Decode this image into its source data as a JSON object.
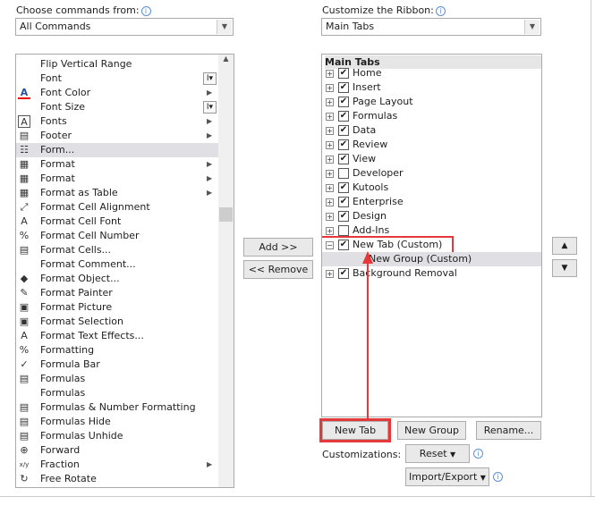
{
  "left": {
    "label": "Choose commands from:",
    "dropdown": "All Commands",
    "items": [
      {
        "label": "Flip Vertical Range",
        "icon": "none"
      },
      {
        "label": "Font",
        "icon": "none",
        "control": "I▾"
      },
      {
        "label": "Font Color",
        "icon": "font-color-icon",
        "sub": true
      },
      {
        "label": "Font Size",
        "icon": "none",
        "control": "I▾"
      },
      {
        "label": "Fonts",
        "icon": "fonts-icon",
        "sub": true
      },
      {
        "label": "Footer",
        "icon": "footer-icon",
        "sub": true
      },
      {
        "label": "Form...",
        "icon": "form-icon",
        "selected": true
      },
      {
        "label": "Format",
        "icon": "format-icon",
        "sub": true
      },
      {
        "label": "Format",
        "icon": "format-table-icon",
        "sub": true
      },
      {
        "label": "Format as Table",
        "icon": "format-as-table-icon",
        "sub": true
      },
      {
        "label": "Format Cell Alignment",
        "icon": "alignment-icon"
      },
      {
        "label": "Format Cell Font",
        "icon": "cell-font-icon"
      },
      {
        "label": "Format Cell Number",
        "icon": "percent-icon"
      },
      {
        "label": "Format Cells...",
        "icon": "format-cells-icon"
      },
      {
        "label": "Format Comment...",
        "icon": "none"
      },
      {
        "label": "Format Object...",
        "icon": "format-object-icon"
      },
      {
        "label": "Format Painter",
        "icon": "format-painter-icon"
      },
      {
        "label": "Format Picture",
        "icon": "format-picture-icon"
      },
      {
        "label": "Format Selection",
        "icon": "format-selection-icon"
      },
      {
        "label": "Format Text Effects...",
        "icon": "text-effects-icon"
      },
      {
        "label": "Formatting",
        "icon": "formatting-icon"
      },
      {
        "label": "Formula Bar",
        "icon": "check-icon"
      },
      {
        "label": "Formulas",
        "icon": "formulas-icon"
      },
      {
        "label": "Formulas",
        "icon": "none"
      },
      {
        "label": "Formulas & Number Formatting",
        "icon": "number-formatting-icon"
      },
      {
        "label": "Formulas Hide",
        "icon": "formulas-hide-icon"
      },
      {
        "label": "Formulas Unhide",
        "icon": "formulas-unhide-icon"
      },
      {
        "label": "Forward",
        "icon": "forward-icon"
      },
      {
        "label": "Fraction",
        "icon": "fraction-icon",
        "sub": true
      },
      {
        "label": "Free Rotate",
        "icon": "rotate-icon"
      }
    ]
  },
  "right": {
    "label": "Customize the Ribbon:",
    "dropdown": "Main Tabs",
    "header": "Main Tabs",
    "items": [
      {
        "label": "Home",
        "checked": true
      },
      {
        "label": "Insert",
        "checked": true
      },
      {
        "label": "Page Layout",
        "checked": true
      },
      {
        "label": "Formulas",
        "checked": true
      },
      {
        "label": "Data",
        "checked": true
      },
      {
        "label": "Review",
        "checked": true
      },
      {
        "label": "View",
        "checked": true
      },
      {
        "label": "Developer",
        "checked": false
      },
      {
        "label": "Kutools",
        "checked": true
      },
      {
        "label": "Enterprise",
        "checked": true
      },
      {
        "label": "Design",
        "checked": true
      },
      {
        "label": "Add-Ins",
        "checked": false
      },
      {
        "label": "New Tab (Custom)",
        "checked": true,
        "expanded": true,
        "highlighted": true
      },
      {
        "label": "New Group (Custom)",
        "group": true
      },
      {
        "label": "Background Removal",
        "checked": true
      }
    ]
  },
  "buttons": {
    "add": "Add >>",
    "remove": "<< Remove",
    "new_tab": "New Tab",
    "new_group": "New Group",
    "rename": "Rename...",
    "reset": "Reset",
    "import_export": "Import/Export",
    "customizations": "Customizations:",
    "up": "▲",
    "down": "▼"
  },
  "colors": {
    "highlight": "#e5383b",
    "selection": "#e0e0e4"
  }
}
